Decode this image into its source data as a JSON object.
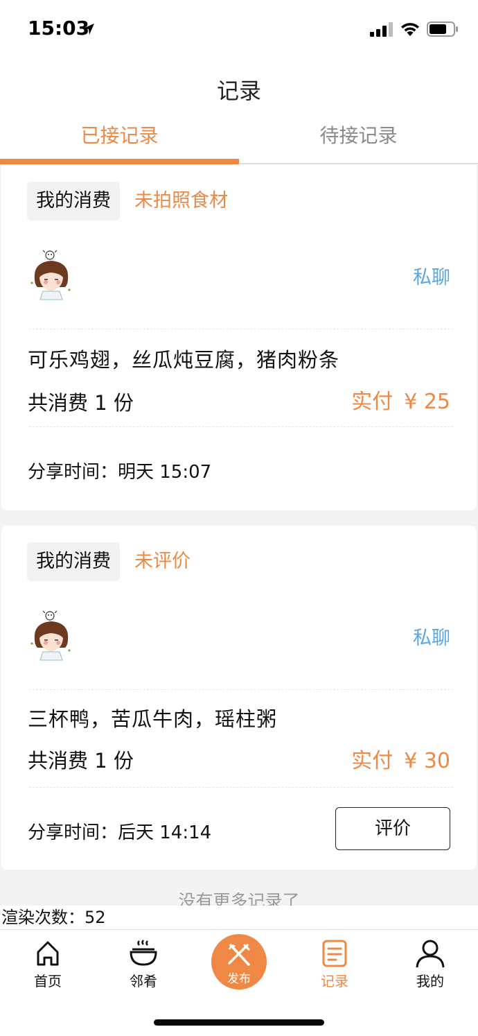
{
  "status_bar": {
    "time": "15:03"
  },
  "nav": {
    "title": "记录"
  },
  "tabs": [
    {
      "label": "已接记录",
      "active": true
    },
    {
      "label": "待接记录",
      "active": false
    }
  ],
  "records": [
    {
      "tag": "我的消费",
      "status": "未拍照食材",
      "chat": "私聊",
      "items": "可乐鸡翅，丝瓜炖豆腐，猪肉粉条",
      "quantity": "共消费 1 份",
      "paid_label": "实付",
      "paid_amount": "¥ 25",
      "share_time": "分享时间：明天 15:07"
    },
    {
      "tag": "我的消费",
      "status": "未评价",
      "chat": "私聊",
      "items": "三杯鸭，苦瓜牛肉，瑶柱粥",
      "quantity": "共消费 1 份",
      "paid_label": "实付",
      "paid_amount": "¥ 30",
      "share_time": "分享时间：后天 14:14",
      "review_button": "评价"
    }
  ],
  "no_more": "没有更多记录了",
  "render_count": "渲染次数：52",
  "tabbar": [
    {
      "label": "首页",
      "icon": "home-icon"
    },
    {
      "label": "邻肴",
      "icon": "bowl-icon"
    },
    {
      "label": "发布",
      "icon": "fork-knife-icon"
    },
    {
      "label": "记录",
      "icon": "notes-icon",
      "active": true
    },
    {
      "label": "我的",
      "icon": "person-icon"
    }
  ],
  "colors": {
    "accent": "#ef8844",
    "link": "#5aa6e0",
    "background": "#f3f3f3"
  }
}
